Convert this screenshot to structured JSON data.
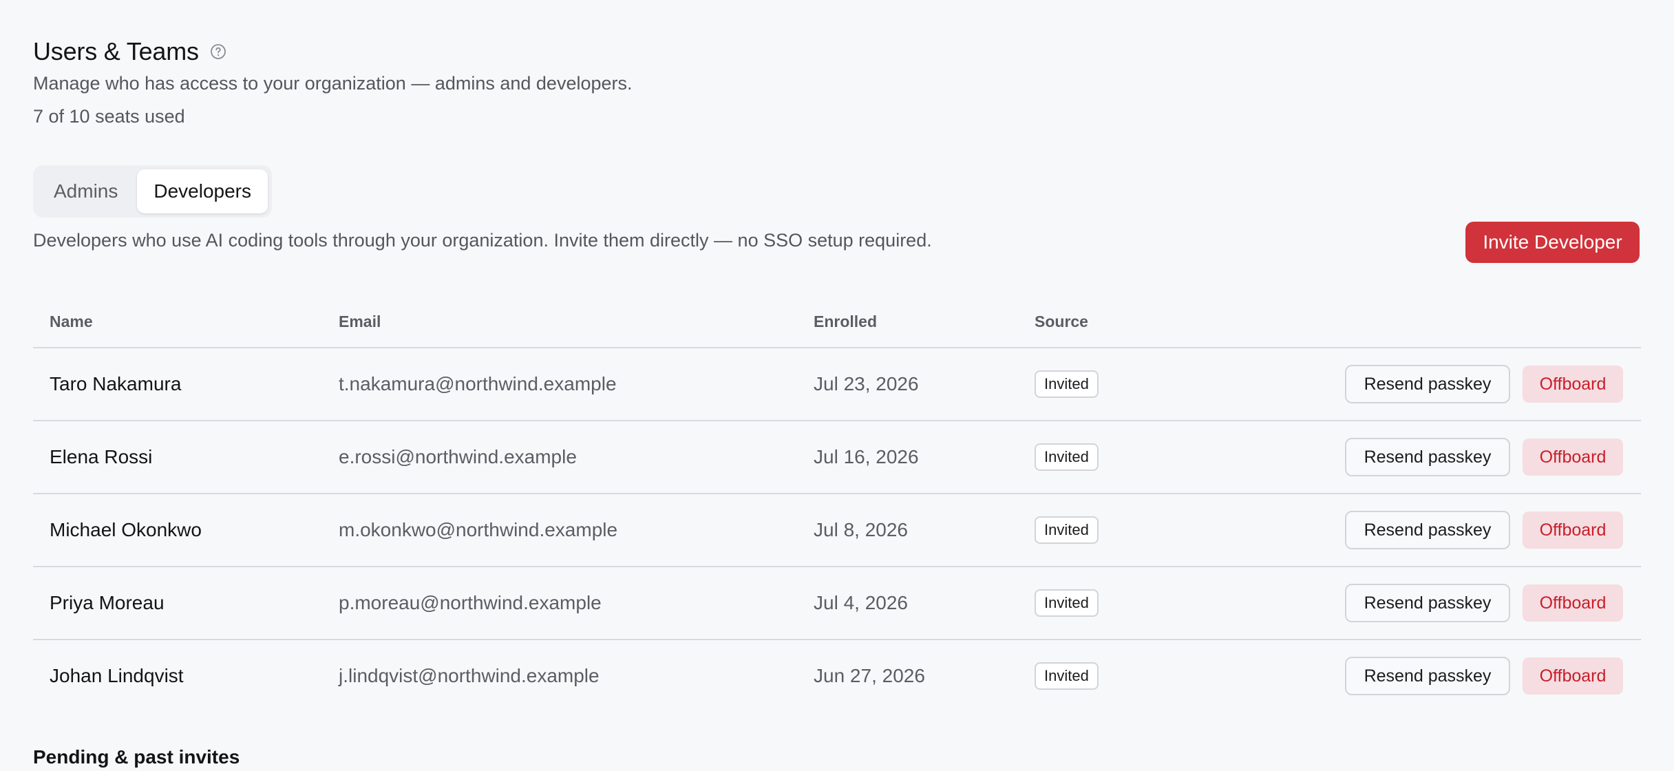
{
  "header": {
    "title": "Users & Teams",
    "help_icon": "question-circle-icon",
    "subtitle": "Manage who has access to your organization — admins and developers.",
    "seats": "7 of 10 seats used"
  },
  "tabs": [
    {
      "label": "Admins",
      "active": false
    },
    {
      "label": "Developers",
      "active": true
    }
  ],
  "section": {
    "description": "Developers who use AI coding tools through your organization. Invite them directly — no SSO setup required.",
    "invite_button": "Invite Developer"
  },
  "table": {
    "columns": {
      "name": "Name",
      "email": "Email",
      "enrolled": "Enrolled",
      "source": "Source"
    },
    "rows": [
      {
        "name": "Taro Nakamura",
        "email": "t.nakamura@northwind.example",
        "enrolled": "Jul 23, 2026",
        "source": "Invited",
        "resend": "Resend passkey",
        "offboard": "Offboard"
      },
      {
        "name": "Elena Rossi",
        "email": "e.rossi@northwind.example",
        "enrolled": "Jul 16, 2026",
        "source": "Invited",
        "resend": "Resend passkey",
        "offboard": "Offboard"
      },
      {
        "name": "Michael Okonkwo",
        "email": "m.okonkwo@northwind.example",
        "enrolled": "Jul 8, 2026",
        "source": "Invited",
        "resend": "Resend passkey",
        "offboard": "Offboard"
      },
      {
        "name": "Priya Moreau",
        "email": "p.moreau@northwind.example",
        "enrolled": "Jul 4, 2026",
        "source": "Invited",
        "resend": "Resend passkey",
        "offboard": "Offboard"
      },
      {
        "name": "Johan Lindqvist",
        "email": "j.lindqvist@northwind.example",
        "enrolled": "Jun 27, 2026",
        "source": "Invited",
        "resend": "Resend passkey",
        "offboard": "Offboard"
      }
    ]
  },
  "pending": {
    "title": "Pending & past invites"
  },
  "colors": {
    "accent": "#d0333b",
    "offboard_text": "#c81e2a",
    "offboard_bg": "#f5dde1",
    "background": "#f7f8fa"
  }
}
